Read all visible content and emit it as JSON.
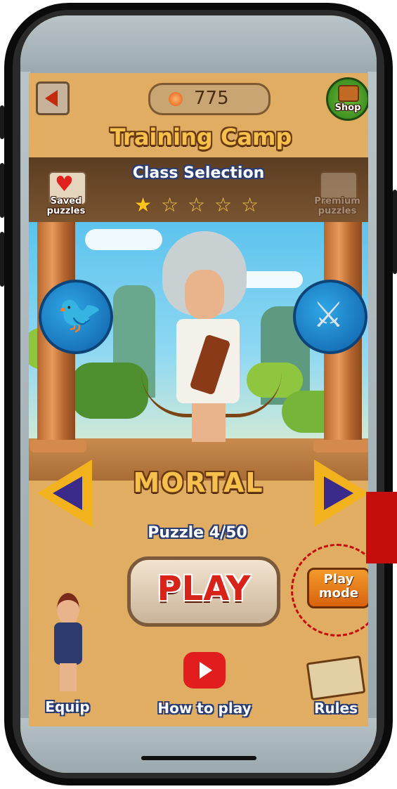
{
  "header": {
    "coins": "775",
    "title": "Training Camp",
    "back_icon": "back-arrow-icon",
    "shop_label": "Shop"
  },
  "class_selection": {
    "title": "Class Selection",
    "stars_filled": 1,
    "stars_total": 5,
    "saved_label": "Saved puzzles",
    "premium_label": "Premium puzzles"
  },
  "difficulty": {
    "label": "MORTAL"
  },
  "puzzle": {
    "progress": "Puzzle 4/50"
  },
  "actions": {
    "play_label": "PLAY",
    "play_mode_line1": "Play",
    "play_mode_line2": "mode"
  },
  "footer": {
    "equip_label": "Equip",
    "howto_label": "How to play",
    "rules_label": "Rules"
  },
  "colors": {
    "accent_gold": "#f5c04c",
    "callout_red": "#c40d0d",
    "play_mode_orange": "#e8761a"
  }
}
